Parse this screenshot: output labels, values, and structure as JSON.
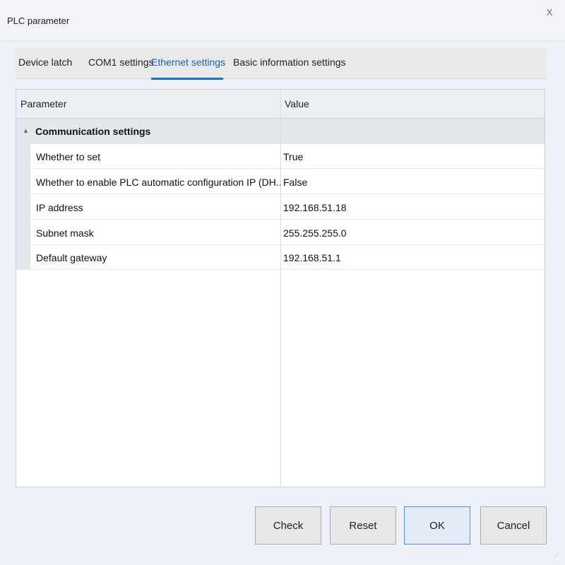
{
  "window": {
    "title": "PLC parameter",
    "close_label": "X"
  },
  "tabs": [
    {
      "label": "Device latch"
    },
    {
      "label": "COM1 settings"
    },
    {
      "label": "Ethernet settings"
    },
    {
      "label": "Basic information settings"
    }
  ],
  "active_tab": "Ethernet settings",
  "grid": {
    "columns": {
      "parameter": "Parameter",
      "value": "Value"
    },
    "group": {
      "label": "Communication settings",
      "expanded_icon": "▲"
    },
    "rows": [
      {
        "parameter": "Whether to set",
        "value": "True"
      },
      {
        "parameter": "Whether to enable PLC automatic configuration IP (DH...",
        "value": "False"
      },
      {
        "parameter": "IP address",
        "value": "192.168.51.18"
      },
      {
        "parameter": "Subnet mask",
        "value": "255.255.255.0"
      },
      {
        "parameter": "Default gateway",
        "value": "192.168.51.1"
      }
    ]
  },
  "buttons": {
    "check": "Check",
    "reset": "Reset",
    "ok": "OK",
    "cancel": "Cancel"
  },
  "colors": {
    "accent": "#1a6fc4",
    "primary_button_border": "#4f8fd6"
  }
}
